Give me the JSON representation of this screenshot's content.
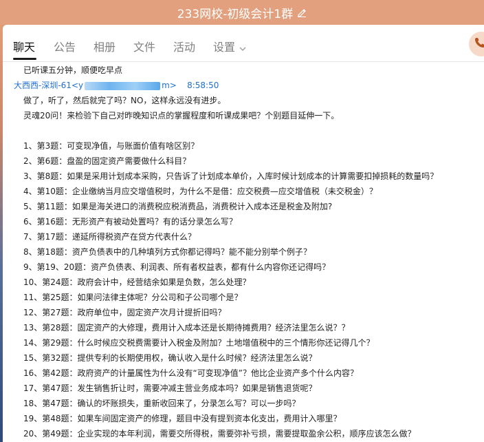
{
  "window": {
    "title": "233网校-初级会计1群"
  },
  "tabs": [
    {
      "label": "聊天"
    },
    {
      "label": "公告"
    },
    {
      "label": "相册"
    },
    {
      "label": "文件"
    },
    {
      "label": "活动"
    },
    {
      "label": "设置"
    }
  ],
  "colors": {
    "accent": "#e2a07e",
    "link": "#1f6fd1"
  },
  "icons": {
    "edit": "edit-icon",
    "dropdown": "chevron-down-icon",
    "call": "phone-icon"
  },
  "messages": {
    "prev_line": "已听课五分钟，顺便吃早点",
    "sender_name": "大西西-深圳-61",
    "sender_email_start": "<y",
    "sender_email_end": "m>",
    "time": "8:58:50",
    "intro1": "做了，听了，然后就完了吗？NO，这样永远没有进步。",
    "intro2": "灵魂20问！来检验下自己对昨晚知识点的掌握程度和听课成果吧？个别题目延伸一下。",
    "questions": [
      "1、第3题：可变现净值，与账面价值有啥区别？",
      "2、第6题：盘盈的固定资产需要做什么科目？",
      "3、第8题：如果是采用计划成本采购，只告诉了计划成本单价，入库时候计划成本的计算需要扣掉损耗的数量吗？",
      "4、第10题：企业缴纳当月应交增值税时，为什么不是借：应交税费—应交增值税（未交税金）？",
      "5、第11题：如果是海关进口的消费税应税消费品，消费税计入成本还是税金及附加?",
      "6、第16题：无形资产有被动处置吗？有的话分录怎么写？",
      "7、第17题：递延所得税资产在贷方代表什么？",
      "8、第18题：资产负债表中的几种填列方式你都记得吗？能不能分别举个例子？",
      "9、第19、20题：资产负债表、利润表、所有者权益表，都有什么内容你还记得吗？",
      "10、第24题：政府会计中，经营结余如果是负数，怎么处理？",
      "11、第25题：如果问法律主体呢？分公司和子公司哪个是？",
      "12、第27题：政府单位中，固定资产次月计提折旧吗？",
      "13、第28题：固定资产的大修理，费用计入成本还是长期待摊费用？经济法里怎么说？？",
      "14、第29题：什么时候应交税费需要计入税金及附加？土地增值税中的三个情形你还记得几个？",
      "15、第32题：提供专利的长期使用权，确认收入是什么时候？经济法里怎么说？",
      "16、第42题：政府资产的计量属性为什么没有“可变现净值”？他比企业资产多个什么内容？",
      "17、第47题：发生销售折让时，需要冲减主营业务成本吗？如果是销售退货呢？",
      "18、第47题：确认的坏账损失，重新收回来了，分录怎么写？可以一步吗？",
      "19、第48题：如果车间固定资产的修理，题目中没有提到资本化支出，费用计入哪里？",
      "20、第49题：企业实现的本年利润，需要交所得税，需要弥补亏损，需要提取盈余公积，顺序应该怎么做？"
    ]
  }
}
